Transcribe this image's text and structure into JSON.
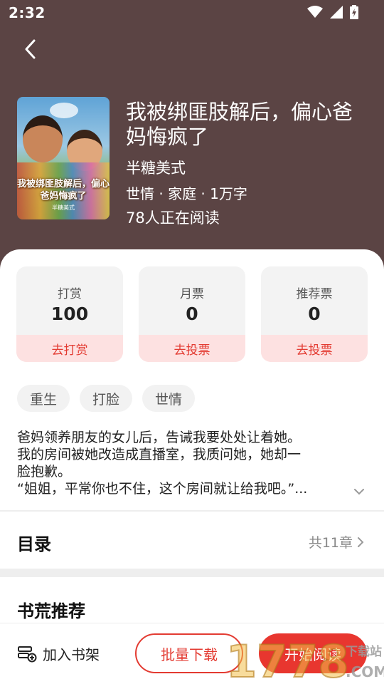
{
  "status_bar": {
    "time": "2:32"
  },
  "book": {
    "cover_title": "我被绑匪肢解后，偏心爸妈悔疯了",
    "cover_author": "半糖美式",
    "title": "我被绑匪肢解后，偏心爸妈悔疯了",
    "author": "半糖美式",
    "meta": "世情 · 家庭 · 1万字",
    "readers": "78人正在阅读"
  },
  "stats": [
    {
      "label": "打赏",
      "value": "100",
      "action": "去打赏"
    },
    {
      "label": "月票",
      "value": "0",
      "action": "去投票"
    },
    {
      "label": "推荐票",
      "value": "0",
      "action": "去投票"
    }
  ],
  "tags": [
    "重生",
    "打脸",
    "世情"
  ],
  "synopsis": [
    "爸妈领养朋友的女儿后，告诫我要处处让着她。",
    "我的房间被她改造成直播室，我质问她，她却一",
    "脸抱歉。",
    "“姐姐，平常你也不住，这个房间就让给我吧。”..."
  ],
  "toc": {
    "title": "目录",
    "count": "共11章"
  },
  "recommend": {
    "title": "书荒推荐"
  },
  "bottom": {
    "shelf_label": "加入书架",
    "download_label": "批量下载",
    "read_label": "开始阅读"
  },
  "watermark": {
    "text": "1778",
    "suffix": ".COM",
    "label": "下载站"
  },
  "colors": {
    "header_bg": "#5b4444",
    "accent": "#e33b32",
    "accent_light": "#fde1e1"
  }
}
